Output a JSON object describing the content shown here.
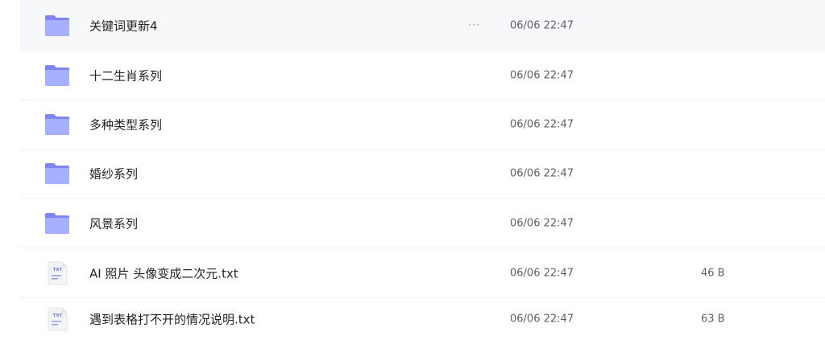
{
  "colors": {
    "folder_back": "#7f86f4",
    "folder_front": "#a7b0ff",
    "txt_page": "#f3f4f8",
    "txt_label": "#6b7fd6",
    "hover_row": "#f7f8fa"
  },
  "rows": [
    {
      "name": "关键词更新4",
      "type": "folder",
      "icon": "folder-icon",
      "more": "···",
      "date": "06/06 22:47",
      "size": ""
    },
    {
      "name": "十二生肖系列",
      "type": "folder",
      "icon": "folder-icon",
      "date": "06/06 22:47",
      "size": ""
    },
    {
      "name": "多种类型系列",
      "type": "folder",
      "icon": "folder-icon",
      "date": "06/06 22:47",
      "size": ""
    },
    {
      "name": "婚纱系列",
      "type": "folder",
      "icon": "folder-icon",
      "date": "06/06 22:47",
      "size": ""
    },
    {
      "name": "风景系列",
      "type": "folder",
      "icon": "folder-icon",
      "date": "06/06 22:47",
      "size": ""
    },
    {
      "name": "AI 照片 头像变成二次元.txt",
      "type": "txt",
      "icon": "txt-file-icon",
      "icon_label": "TXT",
      "date": "06/06 22:47",
      "size": "46 B"
    },
    {
      "name": "遇到表格打不开的情况说明.txt",
      "type": "txt",
      "icon": "txt-file-icon",
      "icon_label": "TXT",
      "date": "06/06 22:47",
      "size": "63 B"
    }
  ]
}
